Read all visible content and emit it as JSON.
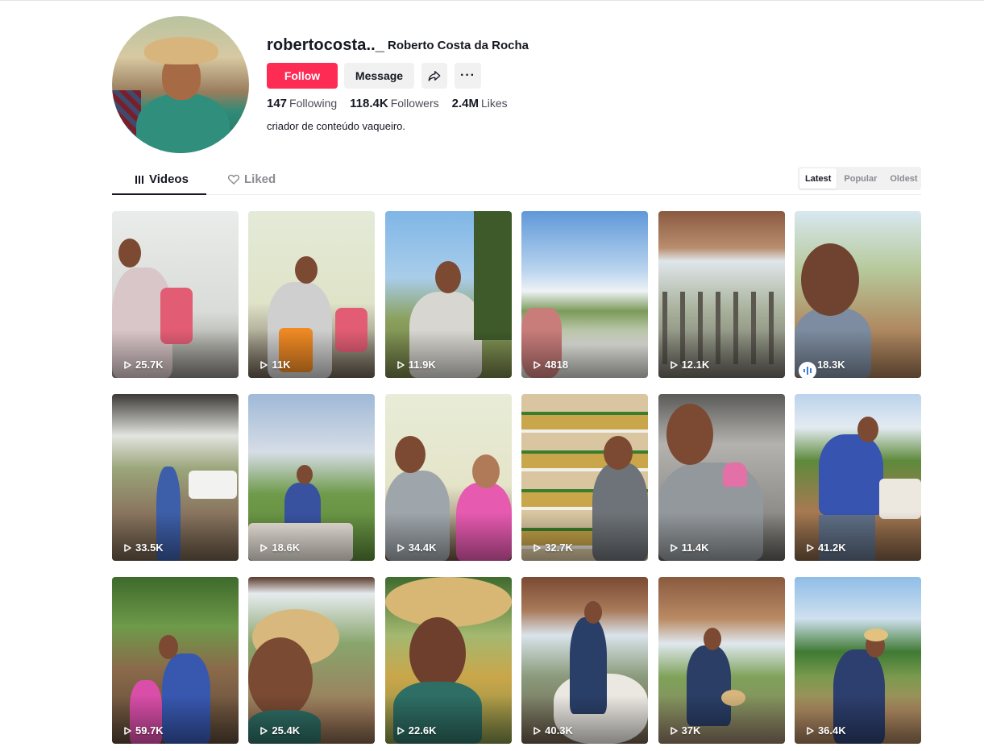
{
  "profile": {
    "username": "robertocosta.._",
    "nickname": "Roberto Costa da Rocha",
    "bio": "criador de conteúdo vaqueiro.",
    "stats": {
      "following_count": "147",
      "following_label": "Following",
      "followers_count": "118.4K",
      "followers_label": "Followers",
      "likes_count": "2.4M",
      "likes_label": "Likes"
    },
    "actions": {
      "follow": "Follow",
      "message": "Message",
      "more": "···"
    }
  },
  "tabs": [
    {
      "label": "Videos",
      "icon": "grid-icon",
      "active": true
    },
    {
      "label": "Liked",
      "icon": "heart-lock-icon",
      "active": false
    }
  ],
  "sort": {
    "options": [
      "Latest",
      "Popular",
      "Oldest"
    ],
    "selected": "Latest"
  },
  "videos": [
    {
      "views": "25.7K"
    },
    {
      "views": "11K"
    },
    {
      "views": "11.9K"
    },
    {
      "views": "4818"
    },
    {
      "views": "12.1K"
    },
    {
      "views": "18.3K"
    },
    {
      "views": "33.5K"
    },
    {
      "views": "18.6K"
    },
    {
      "views": "34.4K"
    },
    {
      "views": "32.7K"
    },
    {
      "views": "11.4K"
    },
    {
      "views": "41.2K"
    },
    {
      "views": "59.7K"
    },
    {
      "views": "25.4K"
    },
    {
      "views": "22.6K"
    },
    {
      "views": "40.3K"
    },
    {
      "views": "37K"
    },
    {
      "views": "36.4K"
    }
  ],
  "colors": {
    "accent": "#fe2c55",
    "text": "#161823",
    "muted": "#8a8b91"
  }
}
